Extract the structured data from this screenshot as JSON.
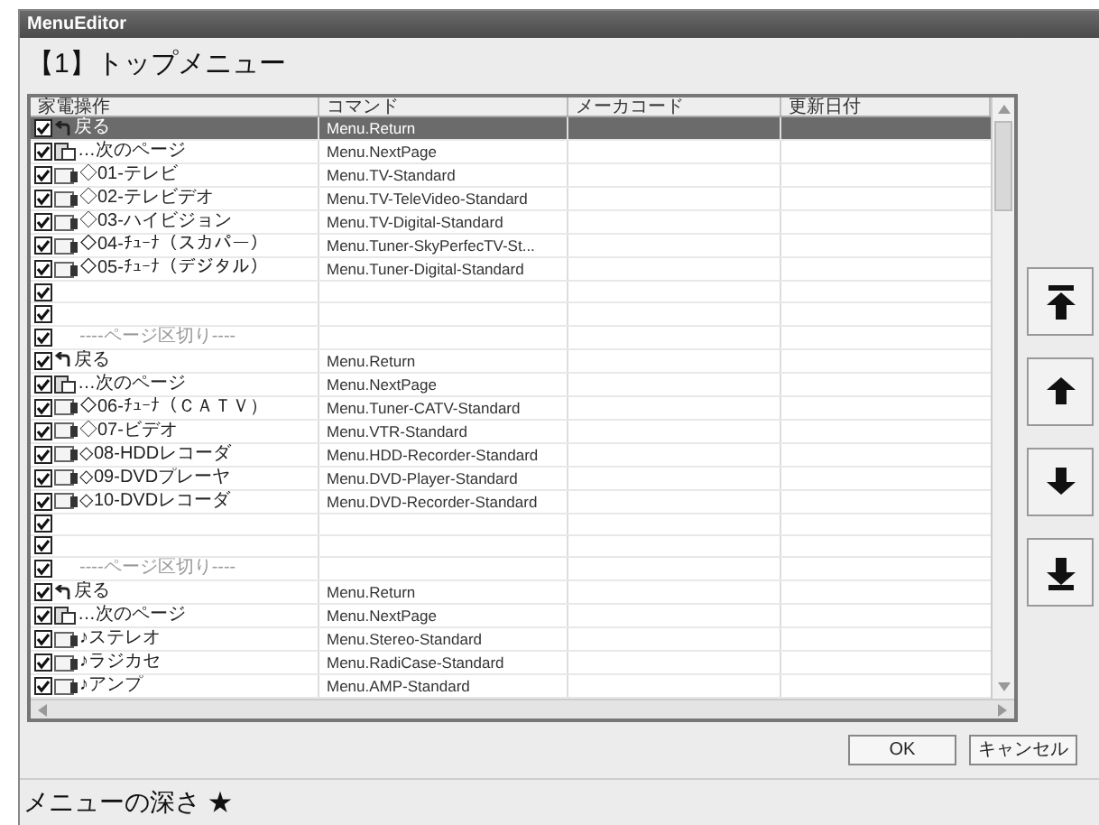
{
  "window": {
    "title": "MenuEditor"
  },
  "heading": "【1】トップメニュー",
  "table": {
    "columns": [
      "家電操作",
      "コマンド",
      "メーカコード",
      "更新日付"
    ],
    "rows": [
      {
        "kind": "back",
        "checked": true,
        "selected": true,
        "label": "戻る",
        "command": "Menu.Return"
      },
      {
        "kind": "next",
        "checked": true,
        "selected": false,
        "label": "…次のページ",
        "command": "Menu.NextPage"
      },
      {
        "kind": "device",
        "checked": true,
        "selected": false,
        "label": "◇01-テレビ",
        "command": "Menu.TV-Standard"
      },
      {
        "kind": "device",
        "checked": true,
        "selected": false,
        "label": "◇02-テレビデオ",
        "command": "Menu.TV-TeleVideo-Standard"
      },
      {
        "kind": "device",
        "checked": true,
        "selected": false,
        "label": "◇03-ハイビジョン",
        "command": "Menu.TV-Digital-Standard"
      },
      {
        "kind": "device",
        "checked": true,
        "selected": false,
        "label": "◇04-ﾁｭｰﾅ（スカパー）",
        "command": "Menu.Tuner-SkyPerfecTV-St..."
      },
      {
        "kind": "device",
        "checked": true,
        "selected": false,
        "label": "◇05-ﾁｭｰﾅ（デジタル）",
        "command": "Menu.Tuner-Digital-Standard"
      },
      {
        "kind": "empty",
        "checked": true,
        "selected": false
      },
      {
        "kind": "empty",
        "checked": true,
        "selected": false
      },
      {
        "kind": "separator",
        "checked": true,
        "selected": false,
        "label": "----ページ区切り----"
      },
      {
        "kind": "back",
        "checked": true,
        "selected": false,
        "label": "戻る",
        "command": "Menu.Return"
      },
      {
        "kind": "next",
        "checked": true,
        "selected": false,
        "label": "…次のページ",
        "command": "Menu.NextPage"
      },
      {
        "kind": "device",
        "checked": true,
        "selected": false,
        "label": "◇06-ﾁｭｰﾅ（ＣＡＴＶ）",
        "command": "Menu.Tuner-CATV-Standard"
      },
      {
        "kind": "device",
        "checked": true,
        "selected": false,
        "label": "◇07-ビデオ",
        "command": "Menu.VTR-Standard"
      },
      {
        "kind": "device",
        "checked": true,
        "selected": false,
        "label": "◇08-HDDレコーダ",
        "command": "Menu.HDD-Recorder-Standard"
      },
      {
        "kind": "device",
        "checked": true,
        "selected": false,
        "label": "◇09-DVDプレーヤ",
        "command": "Menu.DVD-Player-Standard"
      },
      {
        "kind": "device",
        "checked": true,
        "selected": false,
        "label": "◇10-DVDレコーダ",
        "command": "Menu.DVD-Recorder-Standard"
      },
      {
        "kind": "empty",
        "checked": true,
        "selected": false
      },
      {
        "kind": "empty",
        "checked": true,
        "selected": false
      },
      {
        "kind": "separator",
        "checked": true,
        "selected": false,
        "label": "----ページ区切り----"
      },
      {
        "kind": "back",
        "checked": true,
        "selected": false,
        "label": "戻る",
        "command": "Menu.Return"
      },
      {
        "kind": "next",
        "checked": true,
        "selected": false,
        "label": "…次のページ",
        "command": "Menu.NextPage"
      },
      {
        "kind": "device",
        "checked": true,
        "selected": false,
        "label": "♪ステレオ",
        "command": "Menu.Stereo-Standard"
      },
      {
        "kind": "device",
        "checked": true,
        "selected": false,
        "label": "♪ラジカセ",
        "command": "Menu.RadiCase-Standard"
      },
      {
        "kind": "device",
        "checked": true,
        "selected": false,
        "label": "♪アンプ",
        "command": "Menu.AMP-Standard"
      }
    ]
  },
  "buttons": [
    "OK",
    "キャンセル"
  ],
  "footer": "メニューの深さ ★"
}
